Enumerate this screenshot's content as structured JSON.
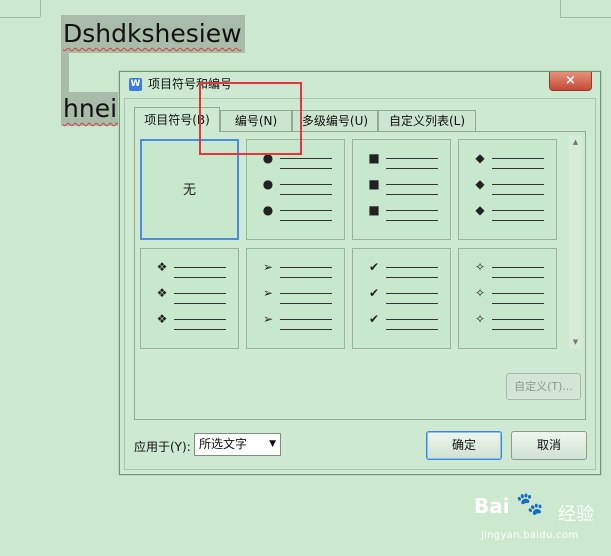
{
  "document": {
    "line1": "Dshdkshesiew",
    "line2": "hneiu"
  },
  "dialog": {
    "title": "项目符号和编号",
    "app_icon": "W",
    "close_label": "×",
    "tabs": [
      {
        "label": "项目符号(B)",
        "active": true
      },
      {
        "label": "编号(N)",
        "active": false
      },
      {
        "label": "多级编号(U)",
        "active": false
      },
      {
        "label": "自定义列表(L)",
        "active": false
      }
    ],
    "bullet_styles": [
      {
        "label": "无",
        "selected": true,
        "symbol": ""
      },
      {
        "symbol": "●",
        "icon": "filled-circle-bullet-icon"
      },
      {
        "symbol": "■",
        "icon": "filled-square-bullet-icon"
      },
      {
        "symbol": "◆",
        "icon": "filled-diamond-bullet-icon"
      },
      {
        "symbol": "❖",
        "icon": "four-diamond-bullet-icon"
      },
      {
        "symbol": "➢",
        "icon": "arrowhead-bullet-icon"
      },
      {
        "symbol": "✔",
        "icon": "checkmark-bullet-icon"
      },
      {
        "symbol": "✧",
        "icon": "four-point-star-bullet-icon"
      }
    ],
    "custom_button": "自定义(T)...",
    "apply_to_label": "应用于(Y):",
    "apply_to_value": "所选文字",
    "ok_button": "确定",
    "cancel_button": "取消"
  },
  "watermark": {
    "brand": "Bai",
    "brand_suffix": "经验",
    "url": "jingyan.baidu.com"
  },
  "colors": {
    "background": "#cce8cf",
    "selection_border": "#4a8de0",
    "annotation": "#e6333d"
  }
}
